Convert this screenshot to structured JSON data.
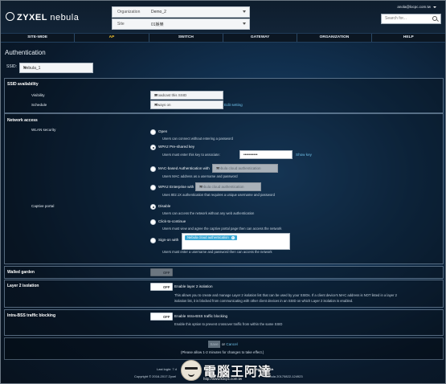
{
  "header": {
    "logo_brand": "ZYXEL",
    "logo_product": "nebula",
    "org_label": "Organization",
    "org_value": "Demo_2",
    "site_label": "Site",
    "site_value": "01娛樂",
    "user": "anola@locpc.com.tw",
    "search_placeholder": "Search for..."
  },
  "nav": {
    "tabs": [
      {
        "label": "SITE-WIDE"
      },
      {
        "label": "AP"
      },
      {
        "label": "SWITCH"
      },
      {
        "label": "GATEWAY"
      },
      {
        "label": "ORGANIZATION"
      },
      {
        "label": "HELP"
      }
    ],
    "active": "AP",
    "active_color": "#f2c230"
  },
  "page": {
    "title": "Authentication",
    "ssid_label": "SSID:",
    "ssid_value": "Nebula_1"
  },
  "ssid_availability": {
    "title": "SSID availability",
    "visibility_label": "Visibility",
    "visibility_value": "Broadcast this SSID",
    "schedule_label": "Schedule",
    "schedule_value": "Always on",
    "edit_link": "Edit setting"
  },
  "network_access": {
    "title": "Network access",
    "wlan_security_label": "WLAN security",
    "open_label": "Open",
    "open_desc": "Users can connect without entering a password",
    "wpa2_psk_label": "WPA2 Pre-shared key",
    "wpa2_psk_desc": "Users must enter this key to associate:",
    "wpa2_psk_value": "••••••••••",
    "show_key": "Show key",
    "mac_label": "MAC-based Authentication with",
    "mac_select": "Nebula cloud authentication",
    "mac_desc": "Users MAC address as a username and password",
    "wpa2_ent_label": "WPA2 Enterprise with",
    "wpa2_ent_select": "Nebula cloud authentication",
    "wpa2_ent_desc": "Uses 802.1X authentication that requires a unique username and password",
    "captive_portal_label": "Captive portal",
    "disable_label": "Disable",
    "disable_desc": "Users can access the network without any web authentication",
    "click_label": "Click-to-continue",
    "click_desc": "Users must view and agree the captive portal page then can access the network",
    "signon_label": "Sign-on with",
    "signon_tag": "Nebula cloud authentication",
    "signon_tag_x": "x",
    "signon_desc": "Users must enter a username and password then can access the network"
  },
  "walled_garden": {
    "title": "Walled garden",
    "toggle": "OFF"
  },
  "layer2": {
    "title": "Layer 2 isolation",
    "toggle": "OFF",
    "label": "Enable layer 2 isolation",
    "desc1": "This allows you to create and manage Layer 2 isolation list that can be used by your SSIDs. If a client device's MAC address is NOT listed in a layer 2",
    "desc2": "isolation list, it is blocked from communicating with other client devices in an SSID on which Layer 2 isolation is enabled."
  },
  "intra_bss": {
    "title": "Intra-BSS traffic blocking",
    "toggle": "OFF",
    "label": "Enable Intra-BSS traffic blocking",
    "desc": "Enable this option to prevent crossover traffic from within the same SSID"
  },
  "footer": {
    "save": "Save",
    "or": "or",
    "cancel": "Cancel",
    "note": "(Please allow 1-2 minutes for changes to take effect.)",
    "last_login": "Last login: 7 d",
    "copyright_prefix": "Copyright © 2016-2017 Zyxel",
    "version": "nebula 20170822-124923",
    "wish": "Make a wish"
  },
  "watermark": {
    "title": "電腦王阿達",
    "url": "http://www.kocpc.com.tw"
  }
}
